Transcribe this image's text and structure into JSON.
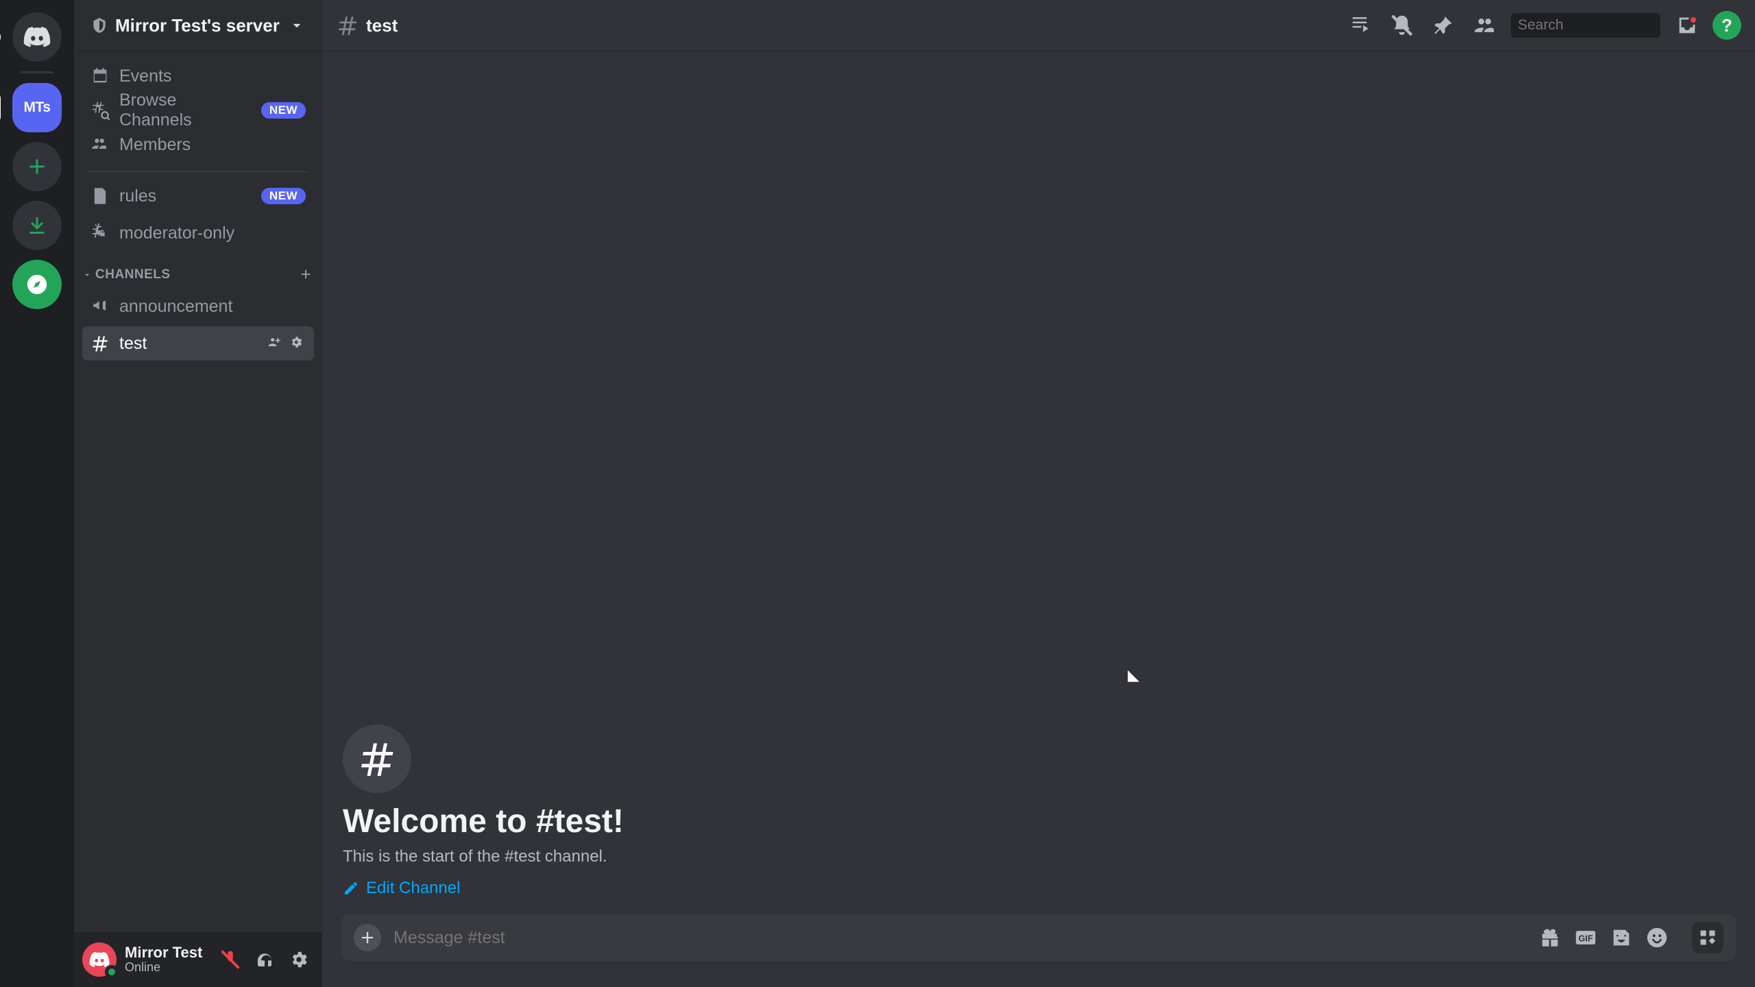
{
  "rail": {
    "home_tooltip": "Direct Messages",
    "server_initials": "MTs",
    "add_server": "Add a Server",
    "download": "Download Apps",
    "discover": "Discover"
  },
  "server": {
    "name": "Mirror Test's server"
  },
  "sidebar": {
    "events": "Events",
    "browse": "Browse Channels",
    "members": "Members",
    "rules": "rules",
    "moderator": "moderator-only",
    "new_badge": "NEW",
    "cat_channels": "CHANNELS",
    "announcement": "announcement",
    "test": "test"
  },
  "user": {
    "name": "Mirror Test",
    "status": "Online"
  },
  "header": {
    "channel": "test",
    "search_placeholder": "Search"
  },
  "welcome": {
    "title": "Welcome to #test!",
    "subtitle": "This is the start of the #test channel.",
    "edit": "Edit Channel"
  },
  "composer": {
    "placeholder": "Message #test"
  },
  "icons": {
    "help": "?"
  }
}
